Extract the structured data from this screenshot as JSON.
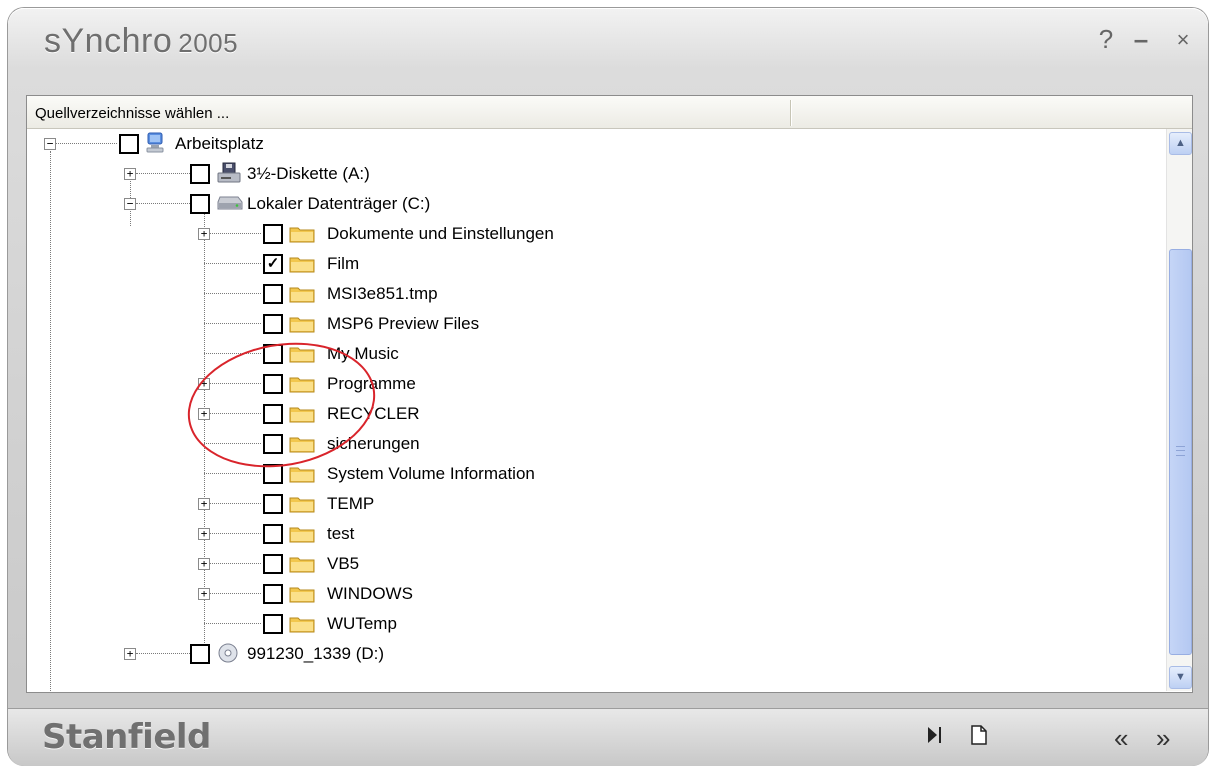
{
  "window": {
    "title": "sYnchro",
    "year": "2005",
    "buttons": {
      "help": "?",
      "minimize": "–",
      "close": "×"
    }
  },
  "panel": {
    "header_label": "Quellverzeichnisse wählen ..."
  },
  "tree": {
    "root": {
      "label": "Arbeitsplatz",
      "icon": "computer-icon",
      "checked": false,
      "expanded": true
    },
    "drives": [
      {
        "label": "3½-Diskette (A:)",
        "icon": "floppy-drive-icon",
        "checked": false,
        "expanded": false
      },
      {
        "label": "Lokaler Datenträger (C:)",
        "icon": "hard-drive-icon",
        "checked": false,
        "expanded": true
      },
      {
        "label": "991230_1339 (D:)",
        "icon": "cd-drive-icon",
        "checked": false,
        "expanded": false
      }
    ],
    "folders": [
      {
        "label": "Dokumente und Einstellungen",
        "checked": false,
        "expandable": true
      },
      {
        "label": "Film",
        "checked": true,
        "expandable": false
      },
      {
        "label": "MSI3e851.tmp",
        "checked": false,
        "expandable": false
      },
      {
        "label": "MSP6 Preview Files",
        "checked": false,
        "expandable": false
      },
      {
        "label": "My Music",
        "checked": false,
        "expandable": false
      },
      {
        "label": "Programme",
        "checked": false,
        "expandable": true
      },
      {
        "label": "RECYCLER",
        "checked": false,
        "expandable": true
      },
      {
        "label": "sicherungen",
        "checked": false,
        "expandable": false
      },
      {
        "label": "System Volume Information",
        "checked": false,
        "expandable": false
      },
      {
        "label": "TEMP",
        "checked": false,
        "expandable": true
      },
      {
        "label": "test",
        "checked": false,
        "expandable": true
      },
      {
        "label": "VB5",
        "checked": false,
        "expandable": true
      },
      {
        "label": "WINDOWS",
        "checked": false,
        "expandable": true
      },
      {
        "label": "WUTemp",
        "checked": false,
        "expandable": false
      }
    ]
  },
  "bottom_bar": {
    "brand": "Stanfield",
    "buttons": {
      "back": "«",
      "forward": "»"
    }
  },
  "colors": {
    "annotation_circle": "#d9242b",
    "scrollbar_thumb": "#b4c8f2",
    "folder": "#f2c74e"
  }
}
